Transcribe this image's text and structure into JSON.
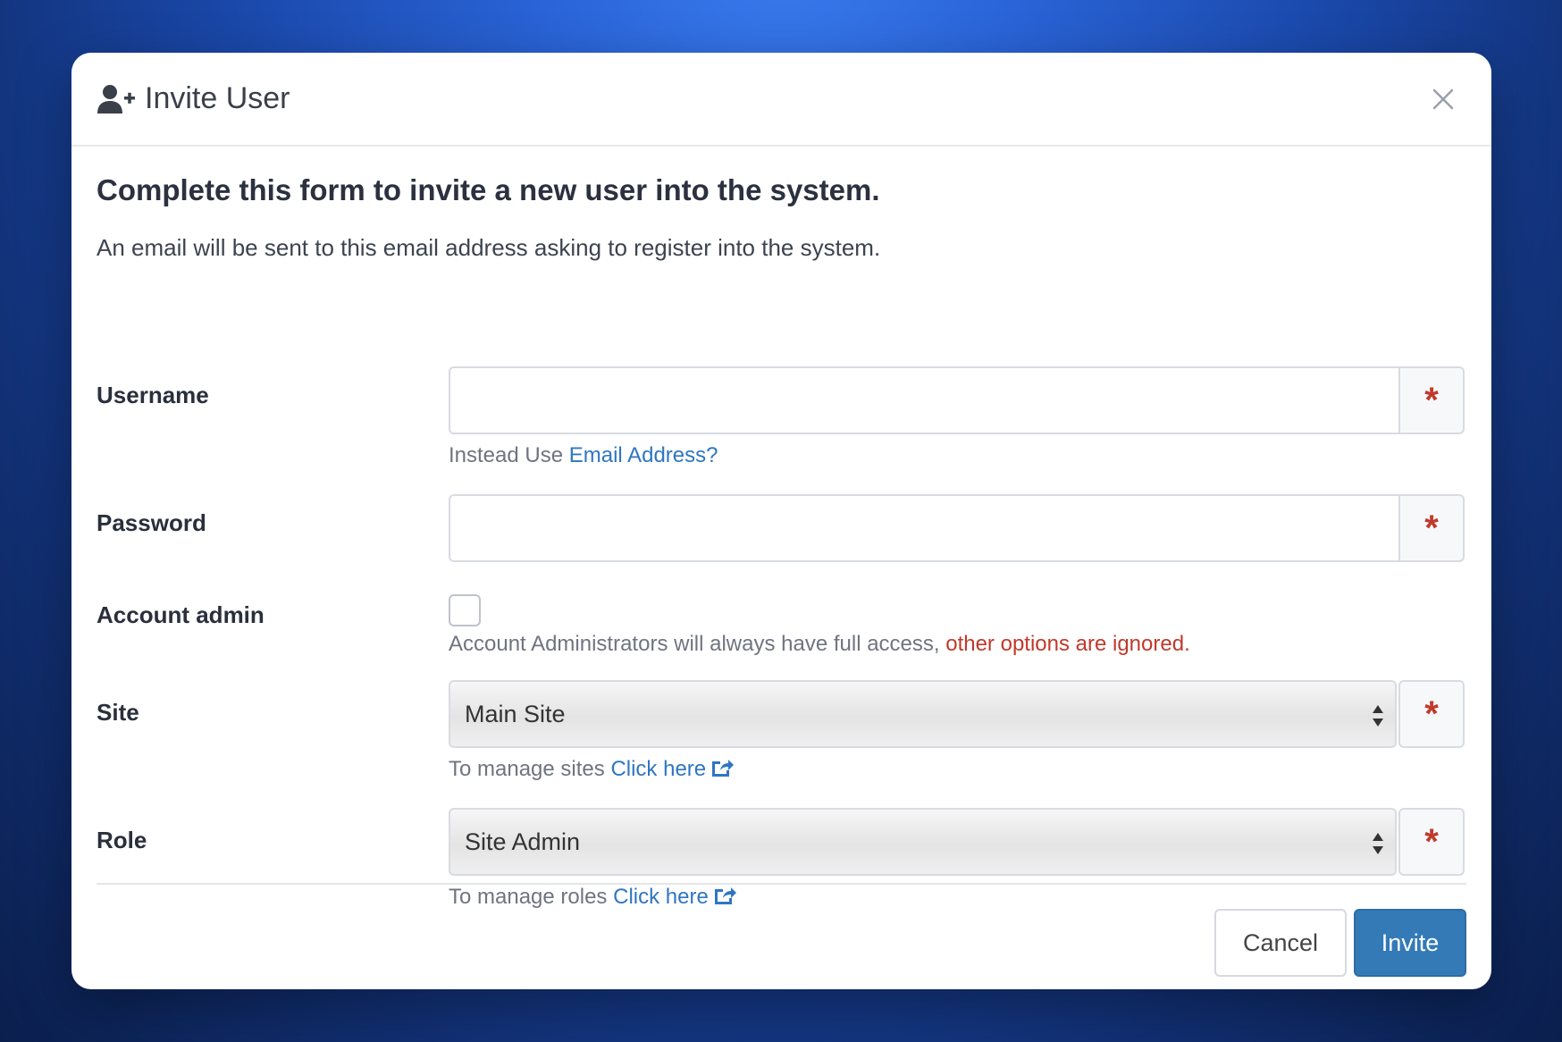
{
  "modal": {
    "title": "Invite User",
    "icons": {
      "title": "user-plus-icon",
      "close": "close-icon"
    }
  },
  "intro": {
    "heading": "Complete this form to invite a new user into the system.",
    "subtext": "An email will be sent to this email address asking to register into the system."
  },
  "form": {
    "username": {
      "label": "Username",
      "value": "",
      "required_mark": "*",
      "help_prefix": "Instead Use ",
      "help_link": "Email Address?"
    },
    "password": {
      "label": "Password",
      "value": "",
      "required_mark": "*"
    },
    "account_admin": {
      "label": "Account admin",
      "checked": false,
      "help_text": "Account Administrators will always have full access, ",
      "help_warning": "other options are ignored."
    },
    "site": {
      "label": "Site",
      "selected": "Main Site",
      "required_mark": "*",
      "help_prefix": "To manage sites ",
      "help_link": "Click here"
    },
    "role": {
      "label": "Role",
      "selected": "Site Admin",
      "required_mark": "*",
      "help_prefix": "To manage roles ",
      "help_link": "Click here"
    }
  },
  "footer": {
    "cancel_label": "Cancel",
    "invite_label": "Invite"
  },
  "colors": {
    "primary": "#337ab7",
    "link": "#2f76c2",
    "danger": "#c0392b",
    "background_top": "#3a7df0",
    "background_bottom": "#0b1f4d"
  }
}
